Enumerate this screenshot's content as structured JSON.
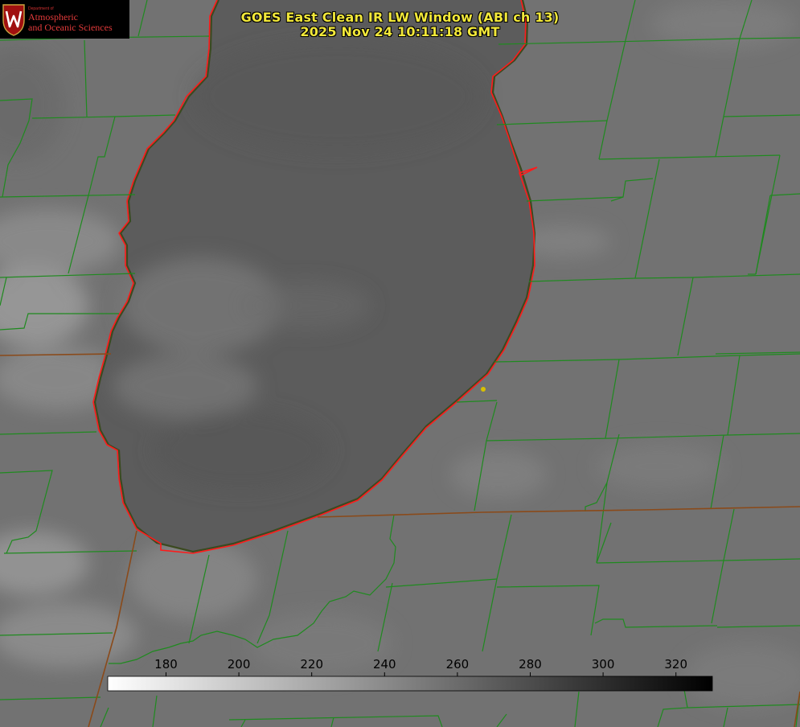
{
  "title": {
    "line1": "GOES East Clean IR LW Window (ABI ch 13)",
    "line2": "2025 Nov 24 10:11:18 GMT"
  },
  "logo": {
    "department": "Department of",
    "line1": "Atmospheric",
    "line2": "and Oceanic Sciences",
    "seal_letter": "W"
  },
  "colorbar": {
    "ticks": [
      "180",
      "200",
      "220",
      "240",
      "260",
      "280",
      "300",
      "320"
    ],
    "tick_values": [
      180,
      200,
      220,
      240,
      260,
      280,
      300,
      320
    ],
    "range": [
      164,
      330
    ],
    "gradient": [
      "#ffffff",
      "#000000"
    ]
  },
  "colors": {
    "county_lines": "#1f8a1f",
    "state_lines": "#8a4a1a",
    "lake_outline": "#ff1a1a",
    "title_text": "#f2e83a",
    "marker": "#d8c000",
    "lake_fill": "#5c5c5c",
    "land_fill": "#707070"
  }
}
